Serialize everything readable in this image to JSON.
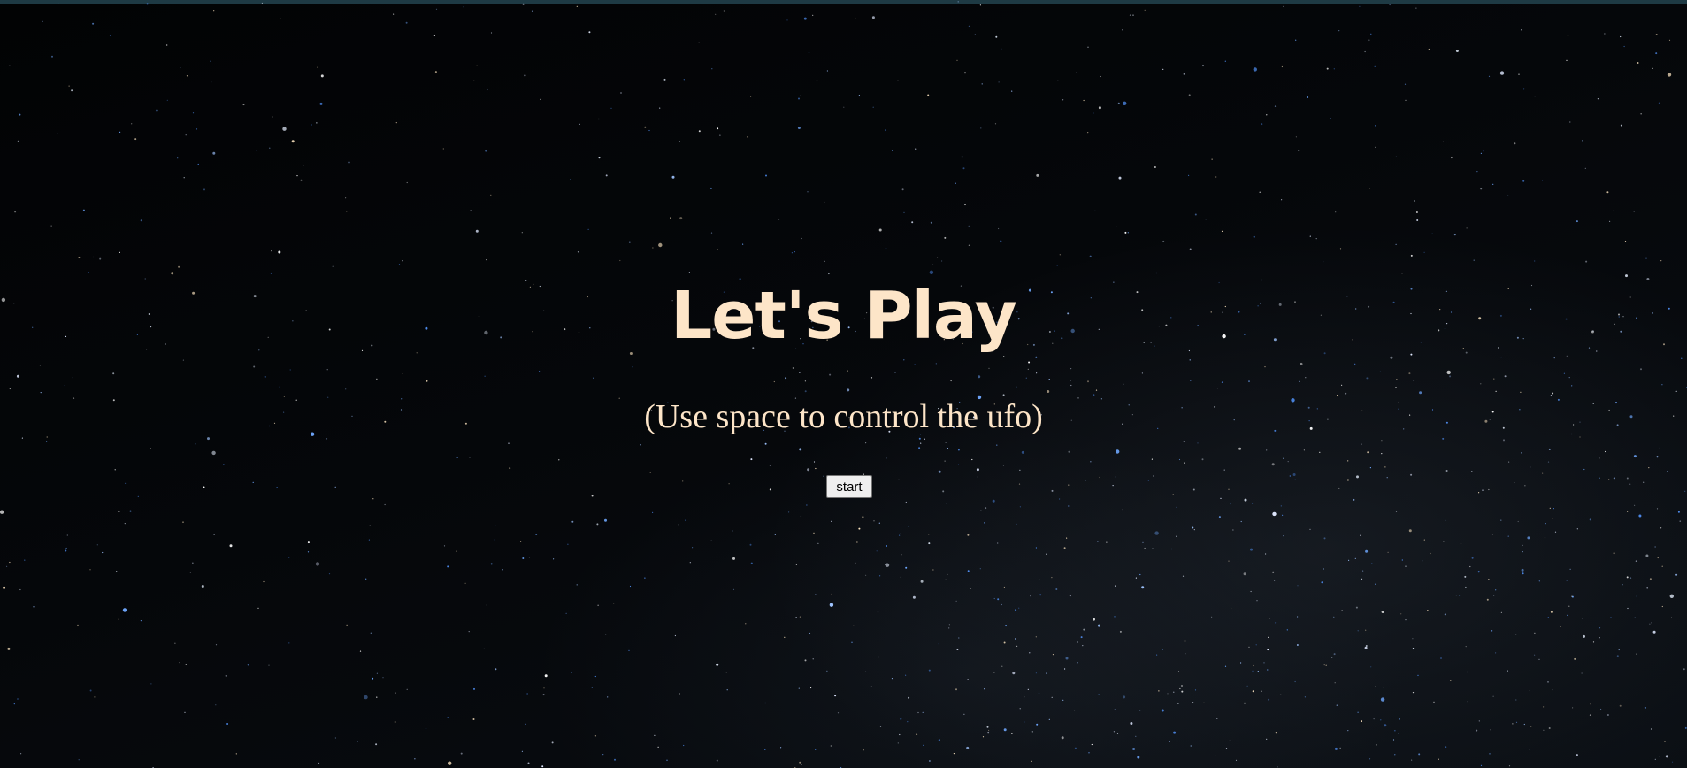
{
  "page": {
    "title": "Let's Play",
    "subtitle": "(Use space to control the ufo)",
    "start_button_label": "start"
  },
  "colors": {
    "title_text": "#fde5c8",
    "subtitle_text": "#fde5c8",
    "background": "#030405",
    "top_strip": "#1e3a44"
  },
  "background": {
    "description_icon": "starfield-background"
  }
}
